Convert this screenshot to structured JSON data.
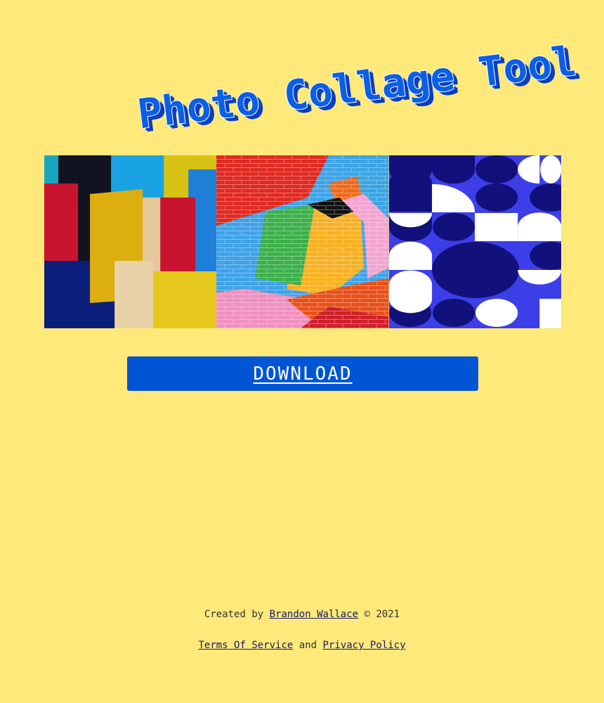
{
  "header": {
    "title": "Photo Collage Tool",
    "title_color": "#0a5fe6",
    "title_shadow_color": "#0a3fbf"
  },
  "collage": {
    "images": [
      {
        "name": "color-blocks-paper"
      },
      {
        "name": "painted-brick-wall"
      },
      {
        "name": "geometric-blue-pattern"
      }
    ]
  },
  "actions": {
    "download_label": "DOWNLOAD",
    "button_color": "#0055d4"
  },
  "footer": {
    "created_by": "Created by",
    "author": "Brandon Wallace",
    "copyright": "© 2021",
    "terms": "Terms Of Service",
    "and": "and",
    "privacy": "Privacy Policy"
  },
  "page": {
    "background": "#ffe97a"
  }
}
